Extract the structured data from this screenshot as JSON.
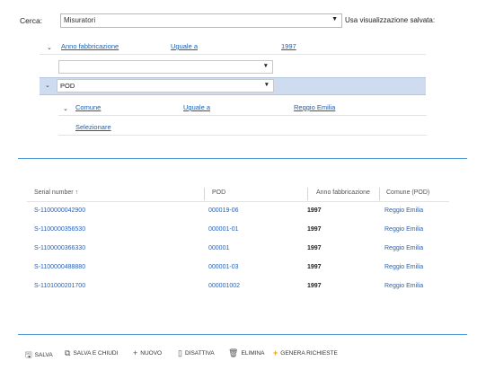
{
  "search": {
    "label": "Cerca:",
    "value": "Misuratori",
    "saved_view_label": "Usa visualizzazione salvata:"
  },
  "filter": {
    "field": "Anno fabbricazione",
    "operator": "Uguale a",
    "value": "1997",
    "empty_field": "",
    "pod_label": "POD",
    "sub_field": "Comune",
    "sub_operator": "Uguale a",
    "sub_value": "Reggio Emilia",
    "select_link": "Selezionare"
  },
  "grid": {
    "columns": [
      "Serial number",
      "POD",
      "Anno fabbricazione",
      "Comune (POD)"
    ],
    "sort_indicator": "↑",
    "rows": [
      {
        "serial": "S-1100000042900",
        "pod": "000019-06",
        "year": "1997",
        "comune": "Reggio Emilia"
      },
      {
        "serial": "S-1100000356530",
        "pod": "000001-01",
        "year": "1997",
        "comune": "Reggio Emilia"
      },
      {
        "serial": "S-1100000366330",
        "pod": "000001",
        "year": "1997",
        "comune": "Reggio Emilia"
      },
      {
        "serial": "S-1100000488880",
        "pod": "000001-03",
        "year": "1997",
        "comune": "Reggio Emilia"
      },
      {
        "serial": "S-1101000201700",
        "pod": "000001002",
        "year": "1997",
        "comune": "Reggio Emilia"
      }
    ]
  },
  "toolbar": {
    "save": "SALVA",
    "save_close": "SALVA E CHIUDI",
    "new": "NUOVO",
    "deactivate": "DISATTIVA",
    "delete": "ELIMINA",
    "generate": "GENERA RICHIESTE"
  },
  "colors": {
    "link": "#2a62b5",
    "selected_row": "#cfdcef",
    "divider": "#4f9bd6",
    "accent": "#f39c12"
  }
}
